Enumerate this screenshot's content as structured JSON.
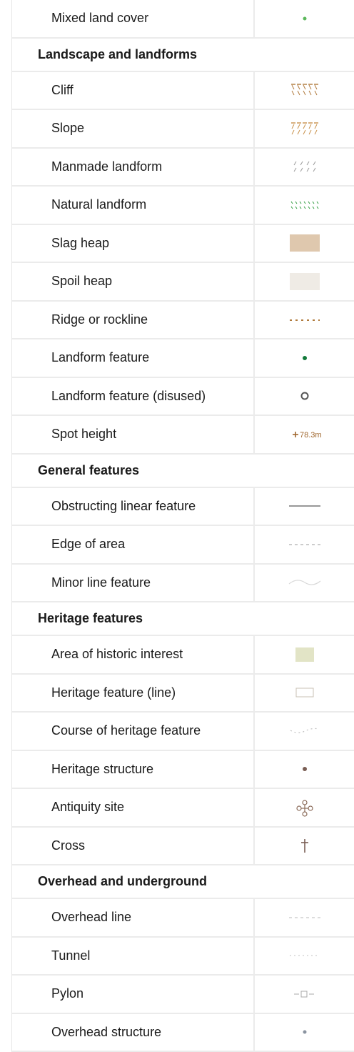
{
  "legend": [
    {
      "type": "item",
      "label": "Mixed land cover",
      "symbol": "dot-green-small",
      "color": "#5cb85c"
    },
    {
      "type": "section",
      "label": "Landscape and landforms"
    },
    {
      "type": "item",
      "label": "Cliff",
      "symbol": "cliff-hatch",
      "color": "#b07a3c"
    },
    {
      "type": "item",
      "label": "Slope",
      "symbol": "slope-hatch",
      "color": "#c8904a"
    },
    {
      "type": "item",
      "label": "Manmade landform",
      "symbol": "manmade-hatch",
      "color": "#999999"
    },
    {
      "type": "item",
      "label": "Natural landform",
      "symbol": "natural-hatch",
      "color": "#2e9b3e"
    },
    {
      "type": "item",
      "label": "Slag heap",
      "symbol": "fill-swatch",
      "color": "#dfc8ae"
    },
    {
      "type": "item",
      "label": "Spoil heap",
      "symbol": "fill-swatch",
      "color": "#efebe5"
    },
    {
      "type": "item",
      "label": "Ridge or rockline",
      "symbol": "dotted-line",
      "color": "#b07a3c"
    },
    {
      "type": "item",
      "label": "Landform feature",
      "symbol": "dot-filled",
      "color": "#137a3b"
    },
    {
      "type": "item",
      "label": "Landform feature (disused)",
      "symbol": "ring",
      "color": "#555555"
    },
    {
      "type": "item",
      "label": "Spot height",
      "symbol": "spot-height",
      "color": "#a0672e",
      "symbol_text": "78.3m"
    },
    {
      "type": "section",
      "label": "General features"
    },
    {
      "type": "item",
      "label": "Obstructing linear feature",
      "symbol": "solid-line",
      "color": "#777777"
    },
    {
      "type": "item",
      "label": "Edge of area",
      "symbol": "dashed-line",
      "color": "#999999"
    },
    {
      "type": "item",
      "label": "Minor line feature",
      "symbol": "wave-line",
      "color": "#d8d8d8"
    },
    {
      "type": "section",
      "label": "Heritage features"
    },
    {
      "type": "item",
      "label": "Area of historic interest",
      "symbol": "fill-swatch-small",
      "color": "#e2e4c6"
    },
    {
      "type": "item",
      "label": "Heritage feature (line)",
      "symbol": "outline-rect",
      "color": "#c8c2b6"
    },
    {
      "type": "item",
      "label": "Course of heritage feature",
      "symbol": "dotted-wave",
      "color": "#c0c0c0"
    },
    {
      "type": "item",
      "label": "Heritage structure",
      "symbol": "dot-filled",
      "color": "#7a5e54"
    },
    {
      "type": "item",
      "label": "Antiquity site",
      "symbol": "antiquity",
      "color": "#8a6a58"
    },
    {
      "type": "item",
      "label": "Cross",
      "symbol": "cross",
      "color": "#7a5e54"
    },
    {
      "type": "section",
      "label": "Overhead and underground"
    },
    {
      "type": "item",
      "label": "Overhead line",
      "symbol": "dashed-line",
      "color": "#b8b8b8"
    },
    {
      "type": "item",
      "label": "Tunnel",
      "symbol": "dotted-small",
      "color": "#c0c0c0"
    },
    {
      "type": "item",
      "label": "Pylon",
      "symbol": "pylon",
      "color": "#aaaaaa"
    },
    {
      "type": "item",
      "label": "Overhead structure",
      "symbol": "dot-small-grey",
      "color": "#8a93a0"
    }
  ]
}
